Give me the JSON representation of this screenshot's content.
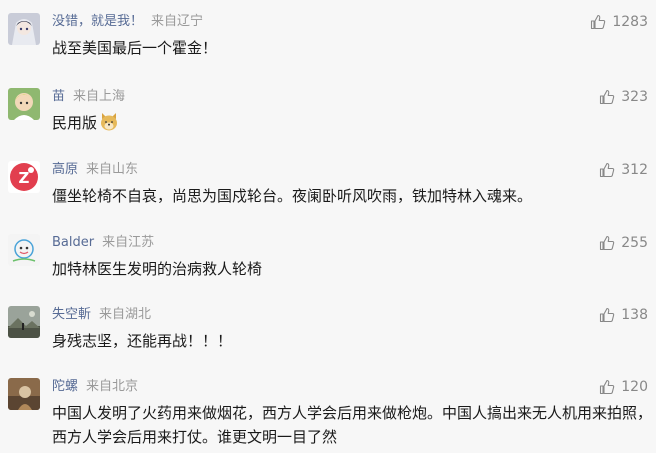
{
  "comments": [
    {
      "nickname": "没错，就是我！",
      "location": "来自辽宁",
      "likes": "1283",
      "text": "战至美国最后一个霍金！",
      "avatar_icon": "anime-avatar-icon"
    },
    {
      "nickname": "苗",
      "location": "来自上海",
      "likes": "323",
      "text": "民用版",
      "emoji_icon": "doge-emoji-icon",
      "avatar_icon": "cartoon-boy-avatar-icon"
    },
    {
      "nickname": "高原",
      "location": "来自山东",
      "likes": "312",
      "text": "僵坐轮椅不自哀，尚思为国戍轮台。夜阑卧听风吹雨，铁加特林入魂来。",
      "avatar_icon": "sleep-z-avatar-icon"
    },
    {
      "nickname": "Balder",
      "location": "来自江苏",
      "likes": "255",
      "text": "加特林医生发明的治病救人轮椅",
      "avatar_icon": "doodle-avatar-icon"
    },
    {
      "nickname": "失空斬",
      "location": "来自湖北",
      "likes": "138",
      "text": "身残志坚，还能再战！！！",
      "avatar_icon": "landscape-avatar-icon"
    },
    {
      "nickname": "陀螺",
      "location": "来自北京",
      "likes": "120",
      "text": "中国人发明了火药用来做烟花，西方人学会后用来做枪炮。中国人搞出来无人机用来拍照，西方人学会后用来打仗。谁更文明一目了然",
      "avatar_icon": "photo-avatar-icon"
    }
  ],
  "colors": {
    "nickname": "#576b95",
    "meta": "#9a9a9a",
    "text": "#1a1a1a",
    "background": "#f7f7f7"
  },
  "like_icon": "thumbs-up-icon"
}
